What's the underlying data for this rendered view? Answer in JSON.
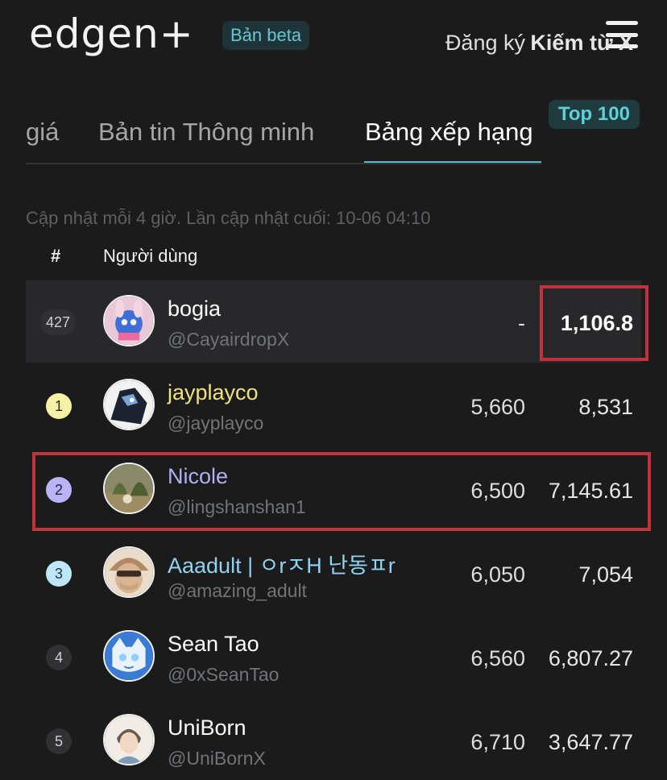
{
  "header": {
    "logo": "edgen+",
    "beta_badge": "Bản beta"
  },
  "tabs": [
    {
      "label": "giá"
    },
    {
      "label": "Bản tin Thông minh"
    },
    {
      "label": "Bảng xếp hạng",
      "active": true
    }
  ],
  "top_badge": "Top 100",
  "updated_text": "Cập nhật mỗi 4 giờ. Lần cập nhật cuối: 10-06 04:10",
  "table": {
    "headers": {
      "rank": "#",
      "user": "Người dùng",
      "registered": "Đăng ký",
      "earned": "Kiếm từ X"
    },
    "current_user": {
      "rank": "427",
      "name": "bogia",
      "handle": "@CayairdropX",
      "registered": "-",
      "earned": "1,106.8"
    },
    "rows": [
      {
        "rank": "1",
        "name": "jayplayco",
        "handle": "@jayplayco",
        "registered": "5,660",
        "earned": "8,531"
      },
      {
        "rank": "2",
        "name": "Nicole",
        "handle": "@lingshanshan1",
        "registered": "6,500",
        "earned": "7,145.61"
      },
      {
        "rank": "3",
        "name": "Aaadult | ㅇrㅈH 난동ㅍr",
        "handle": "@amazing_adult",
        "registered": "6,050",
        "earned": "7,054"
      },
      {
        "rank": "4",
        "name": "Sean Tao",
        "handle": "@0xSeanTao",
        "registered": "6,560",
        "earned": "6,807.27"
      },
      {
        "rank": "5",
        "name": "UniBorn",
        "handle": "@UniBornX",
        "registered": "6,710",
        "earned": "3,647.77"
      }
    ]
  },
  "colors": {
    "background": "#1b1b1c",
    "accent": "#4fb8cf",
    "rank1": "#f7f1a6",
    "rank2": "#bab4f6",
    "rank3": "#bde7f8",
    "highlight": "#c0323c"
  },
  "icons": {
    "menu": "hamburger-menu-icon"
  }
}
